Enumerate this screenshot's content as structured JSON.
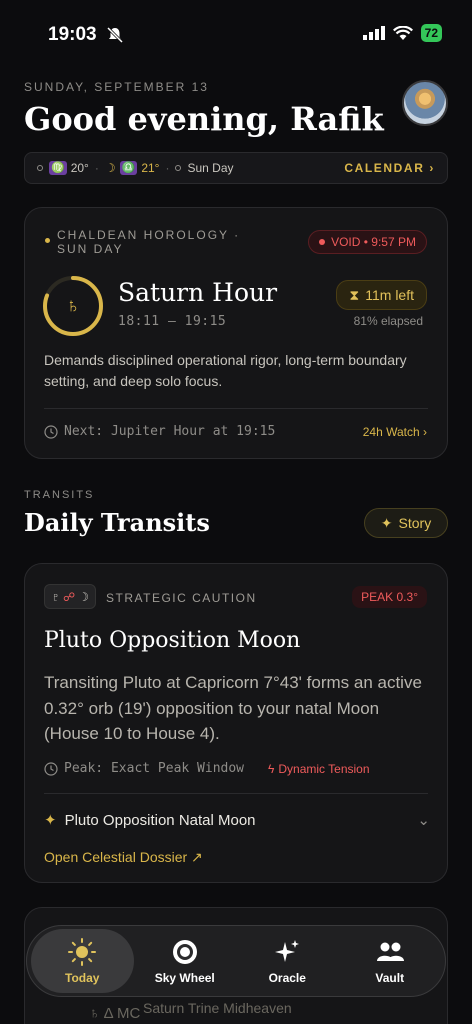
{
  "status": {
    "time": "19:03",
    "battery": "72"
  },
  "header": {
    "date": "SUNDAY, SEPTEMBER 13",
    "greeting": "Good evening, Rafik"
  },
  "chips": {
    "sun_sign": "♍",
    "sun_deg": "20°",
    "moon_sign": "♎",
    "moon_deg": "21°",
    "day": "Sun Day",
    "calendar": "CALENDAR ›"
  },
  "hour_card": {
    "kicker_line1": "CHALDEAN HOROLOGY ·",
    "kicker_line2": "SUN DAY",
    "void": "VOID • 9:57 PM",
    "glyph": "♄",
    "title": "Saturn Hour",
    "range": "18:11 — 19:15",
    "left": "11m left",
    "elapsed": "81% elapsed",
    "elapsed_fraction": 0.81,
    "description": "Demands disciplined operational rigor, long-term boundary setting, and deep solo focus.",
    "next": "Next: Jupiter Hour at 19:15",
    "watch": "24h Watch ›"
  },
  "transits": {
    "kicker": "TRANSITS",
    "title": "Daily Transits",
    "story": "Story"
  },
  "transit_card": {
    "kicker": "STRATEGIC CAUTION",
    "peak": "PEAK 0.3°",
    "title": "Pluto Opposition Moon",
    "description": "Transiting Pluto at Capricorn 7°43' forms an active 0.32° orb (19') opposition to your natal Moon (House 10 to House 4).",
    "peak_line": "Peak: Exact Peak Window",
    "tension": "Dynamic Tension",
    "natal": "Pluto Opposition Natal Moon",
    "dossier": "Open Celestial Dossier ↗"
  },
  "peek_card": {
    "glyph": "♄ Δ MC",
    "title": "Saturn Trine Midheaven"
  },
  "tabs": [
    {
      "label": "Today",
      "icon": "sun-icon",
      "active": true
    },
    {
      "label": "Sky Wheel",
      "icon": "wheel-icon",
      "active": false
    },
    {
      "label": "Oracle",
      "icon": "sparkles-icon",
      "active": false
    },
    {
      "label": "Vault",
      "icon": "people-icon",
      "active": false
    }
  ],
  "colors": {
    "accent": "#d9b64a",
    "danger": "#ef5b5b",
    "background": "#0c0c0e"
  }
}
